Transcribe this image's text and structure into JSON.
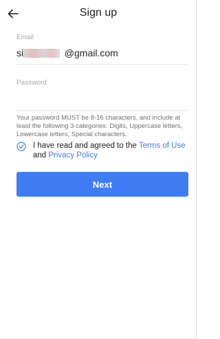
{
  "header": {
    "title": "Sign up",
    "back_icon": "arrow-left-icon"
  },
  "email": {
    "label": "Email",
    "value_prefix": "sir",
    "value_suffix": "@gmail.com"
  },
  "password": {
    "label": "Password",
    "value": ""
  },
  "hint": "Your password MUST be 8-16 characters, and include at least the following 3 categories: Digits, Uppercase letters, Lowercase letters, Special characters.",
  "agreement": {
    "checked": true,
    "check_icon": "check-circle-icon",
    "text_before": "I have read and agreed to the ",
    "terms_link": "Terms of Use",
    "text_and": " and ",
    "privacy_link": "Privacy Policy"
  },
  "next_button": {
    "label": "Next"
  },
  "colors": {
    "accent": "#3f7df5",
    "link": "#3d7cf0"
  }
}
